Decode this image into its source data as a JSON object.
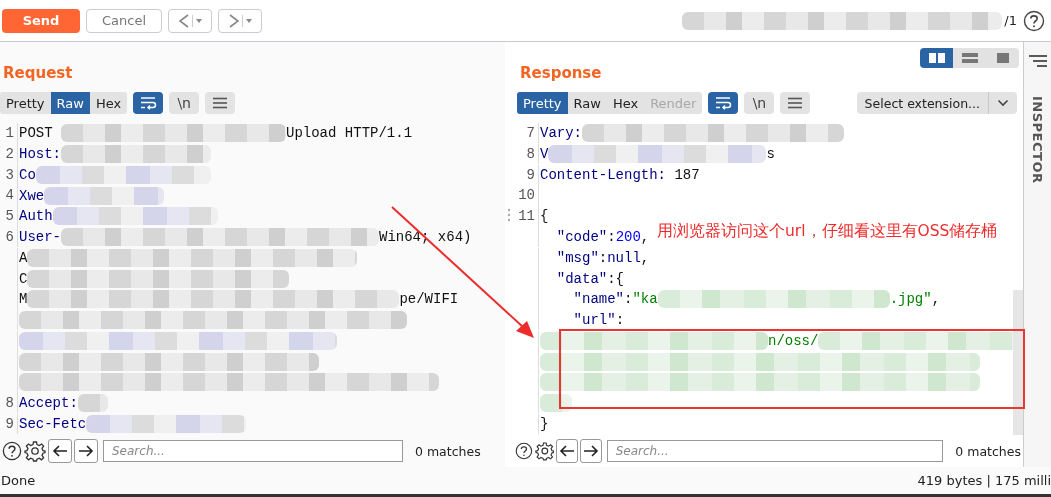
{
  "toolbar": {
    "buttons": [
      {
        "label": "Send",
        "kind": "primary"
      },
      {
        "label": "Cancel",
        "kind": "plain"
      }
    ],
    "page_counter": "/1"
  },
  "request": {
    "title": "Request",
    "view_tabs": [
      {
        "label": "Pretty",
        "selected": false,
        "disabled": false
      },
      {
        "label": "Raw",
        "selected": true,
        "disabled": false
      },
      {
        "label": "Hex",
        "selected": false,
        "disabled": false
      }
    ],
    "wrap_on": true,
    "newline_label": "\\n",
    "lines": [
      {
        "no": "1",
        "parts": [
          {
            "kind": "plain",
            "text": "POST "
          },
          {
            "kind": "blur"
          },
          {
            "kind": "plain",
            "text": "Upload HTTP/1.1"
          }
        ]
      },
      {
        "no": "2",
        "parts": [
          {
            "kind": "key",
            "text": "Host:"
          },
          {
            "kind": "blur"
          }
        ]
      },
      {
        "no": "3",
        "parts": [
          {
            "kind": "key",
            "text": "Co"
          },
          {
            "kind": "blur"
          }
        ]
      },
      {
        "no": "4",
        "parts": [
          {
            "kind": "key",
            "text": "Xwe"
          },
          {
            "kind": "blur"
          }
        ]
      },
      {
        "no": "5",
        "parts": [
          {
            "kind": "key",
            "text": "Auth"
          },
          {
            "kind": "blur"
          }
        ]
      },
      {
        "no": "6",
        "parts": [
          {
            "kind": "key",
            "text": "User-"
          },
          {
            "kind": "blur"
          },
          {
            "kind": "plain",
            "text": "Win64; x64)"
          }
        ]
      },
      {
        "parts": [
          {
            "kind": "plain",
            "text": "A"
          },
          {
            "kind": "blur"
          }
        ]
      },
      {
        "parts": [
          {
            "kind": "plain",
            "text": "C"
          },
          {
            "kind": "blur"
          }
        ]
      },
      {
        "parts": [
          {
            "kind": "plain",
            "text": "M"
          },
          {
            "kind": "blur"
          },
          {
            "kind": "plain",
            "text": "pe/WIFI"
          }
        ]
      },
      {
        "parts": [
          {
            "kind": "blur"
          }
        ]
      },
      {
        "parts": [
          {
            "kind": "blur"
          }
        ]
      },
      {
        "parts": [
          {
            "kind": "blur"
          }
        ]
      },
      {
        "parts": [
          {
            "kind": "blur"
          }
        ]
      },
      {
        "no": "8",
        "parts": [
          {
            "kind": "key",
            "text": "Accept:"
          },
          {
            "kind": "blur"
          }
        ]
      },
      {
        "no": "9",
        "parts": [
          {
            "kind": "key",
            "text": "Sec-Fetc"
          },
          {
            "kind": "blur"
          }
        ]
      }
    ],
    "search": {
      "placeholder": "Search...",
      "matches": "0 matches"
    }
  },
  "response": {
    "title": "Response",
    "layout_buttons": [
      {
        "selected": true
      },
      {
        "selected": false
      },
      {
        "selected": false
      }
    ],
    "view_tabs": [
      {
        "label": "Pretty",
        "selected": true,
        "disabled": false
      },
      {
        "label": "Raw",
        "selected": false,
        "disabled": false
      },
      {
        "label": "Hex",
        "selected": false,
        "disabled": false
      },
      {
        "label": "Render",
        "selected": false,
        "disabled": true
      }
    ],
    "wrap_on": true,
    "newline_label": "\\n",
    "extension_select": "Select extension...",
    "lines": [
      {
        "no": "7",
        "parts": [
          {
            "kind": "key",
            "text": "Vary:"
          },
          {
            "kind": "blur"
          }
        ]
      },
      {
        "no": "8",
        "parts": [
          {
            "kind": "key",
            "text": "V"
          },
          {
            "kind": "blur"
          },
          {
            "kind": "plain",
            "text": "s"
          }
        ]
      },
      {
        "no": "9",
        "parts": [
          {
            "kind": "key",
            "text": "Content-Length:"
          },
          {
            "kind": "plain",
            "text": " 187"
          }
        ]
      },
      {
        "no": "10"
      },
      {
        "no": "11",
        "parts": [
          {
            "kind": "plain",
            "text": "{"
          }
        ]
      },
      {
        "parts": [
          {
            "kind": "key",
            "text": "  \"code\""
          },
          {
            "kind": "plain",
            "text": ":"
          },
          {
            "kind": "number",
            "text": "200"
          },
          {
            "kind": "plain",
            "text": ","
          }
        ]
      },
      {
        "parts": [
          {
            "kind": "key",
            "text": "  \"msg\""
          },
          {
            "kind": "plain",
            "text": ":"
          },
          {
            "kind": "key",
            "text": "null"
          },
          {
            "kind": "plain",
            "text": ","
          }
        ]
      },
      {
        "parts": [
          {
            "kind": "key",
            "text": "  \"data\""
          },
          {
            "kind": "plain",
            "text": ":{"
          }
        ]
      },
      {
        "parts": [
          {
            "kind": "key",
            "text": "    \"name\""
          },
          {
            "kind": "plain",
            "text": ":"
          },
          {
            "kind": "string",
            "text": "\"ka"
          },
          {
            "kind": "blur"
          },
          {
            "kind": "string",
            "text": ".jpg\""
          },
          {
            "kind": "plain",
            "text": ","
          }
        ]
      },
      {
        "parts": [
          {
            "kind": "key",
            "text": "    \"url\""
          },
          {
            "kind": "plain",
            "text": ":"
          }
        ]
      },
      {
        "parts": [
          {
            "kind": "blur"
          },
          {
            "kind": "string",
            "text": "n/oss/"
          },
          {
            "kind": "blur"
          }
        ]
      },
      {
        "parts": [
          {
            "kind": "blur"
          }
        ]
      },
      {
        "parts": [
          {
            "kind": "blur"
          }
        ]
      },
      {
        "parts": [
          {
            "kind": "blur"
          }
        ]
      },
      {
        "parts": [
          {
            "kind": "plain",
            "text": "}"
          }
        ]
      }
    ],
    "search": {
      "placeholder": "Search...",
      "matches": "0 matches"
    }
  },
  "annotation": {
    "text": "用浏览器访问这个url，仔细看这里有OSS储存桶"
  },
  "inspector": {
    "label": "INSPECTOR"
  },
  "status_bar": {
    "left": "Done",
    "right": "419 bytes | 175 milli"
  }
}
